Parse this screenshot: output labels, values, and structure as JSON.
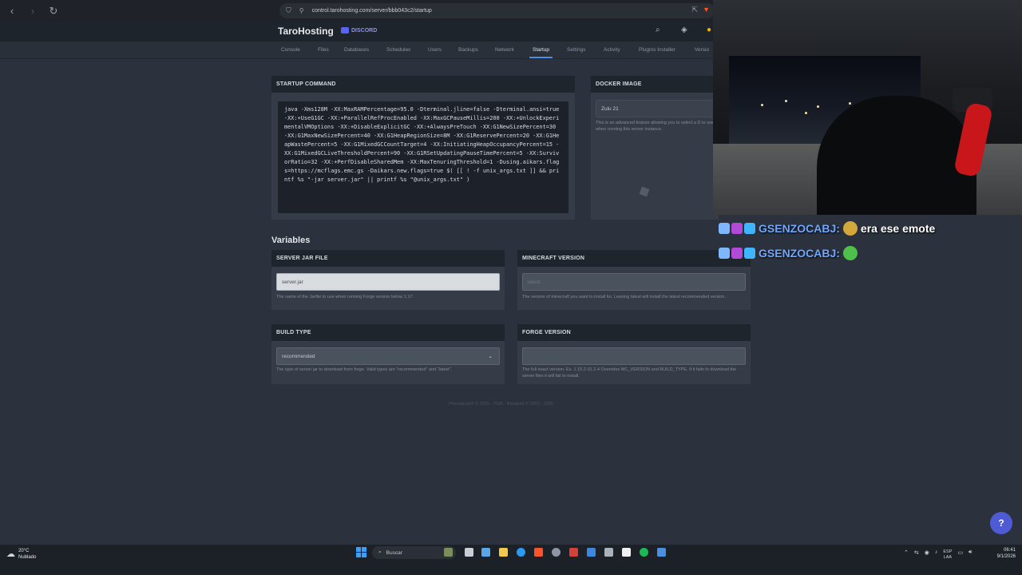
{
  "browser": {
    "url": "control.tarohosting.com/server/bbb043c2/startup"
  },
  "header": {
    "brand": "TaroHosting",
    "discord_label": "DISCORD"
  },
  "tabs": [
    {
      "label": "Console"
    },
    {
      "label": "Files"
    },
    {
      "label": "Databases"
    },
    {
      "label": "Schedules"
    },
    {
      "label": "Users"
    },
    {
      "label": "Backups"
    },
    {
      "label": "Network"
    },
    {
      "label": "Startup"
    },
    {
      "label": "Settings"
    },
    {
      "label": "Activity"
    },
    {
      "label": "Plugins Installer"
    },
    {
      "label": "Versio"
    }
  ],
  "startup": {
    "title": "STARTUP COMMAND",
    "command": "java -Xms128M -XX:MaxRAMPercentage=95.0 -Dterminal.jline=false -Dterminal.ansi=true -XX:+UseG1GC -XX:+ParallelRefProcEnabled -XX:MaxGCPauseMillis=200 -XX:+UnlockExperimentalVMOptions -XX:+DisableExplicitGC -XX:+AlwaysPreTouch -XX:G1NewSizePercent=30 -XX:G1MaxNewSizePercent=40 -XX:G1HeapRegionSize=8M -XX:G1ReservePercent=20 -XX:G1HeapWastePercent=5 -XX:G1MixedGCCountTarget=4 -XX:InitiatingHeapOccupancyPercent=15 -XX:G1MixedGCLiveThresholdPercent=90 -XX:G1RSetUpdatingPauseTimePercent=5 -XX:SurvivorRatio=32 -XX:+PerfDisableSharedMem -XX:MaxTenuringThreshold=1 -Dusing.aikars.flags=https://mcflags.emc.gs -Daikars.new.flags=true $( [[ ! -f unix_args.txt ]] && printf %s \"-jar server.jar\" || printf %s \"@unix_args.txt\" )"
  },
  "docker": {
    "title": "DOCKER IMAGE",
    "value": "Zulu 21",
    "help": "This is an advanced feature allowing you to select a D to use when running this server instance."
  },
  "variables": {
    "title": "Variables",
    "items": [
      {
        "title": "SERVER JAR FILE",
        "value": "server.jar",
        "help": "The name of the Jarfile to use when running Forge version below 1.17."
      },
      {
        "title": "MINECRAFT VERSION",
        "value": "latest",
        "help": "The version of minecraft you want to install for. Leaving latest will install the latest recommended version."
      },
      {
        "title": "BUILD TYPE",
        "value": "recommended",
        "help": "The type of server jar to download from forge. Valid types are \"recommended\" and \"latest\"."
      },
      {
        "title": "FORGE VERSION",
        "value": "",
        "help": "The full exact version. Ex. 1.15.2-31.2.4 Overrides MC_VERSION and BUILD_TYPE. If it fails to download the server files it will fail to install."
      }
    ]
  },
  "footer": "Pterodactyl® © 2015 - 2026 · Blueprint © 2023 - 2026",
  "chat": [
    {
      "user": "GSENZOCABJ:",
      "message": "era ese emote"
    },
    {
      "user": "GSENZOCABJ:",
      "message": ""
    }
  ],
  "help_fab": "?",
  "taskbar": {
    "temp": "20°C",
    "weather": "Nublado",
    "search": "Buscar",
    "lang1": "ESP",
    "lang2": "LAA",
    "time": "06:41",
    "date": "9/1/2026"
  },
  "colors": {
    "accent": "#4a90e2",
    "username": "#6fa6ff",
    "mic": "#c8161a"
  }
}
